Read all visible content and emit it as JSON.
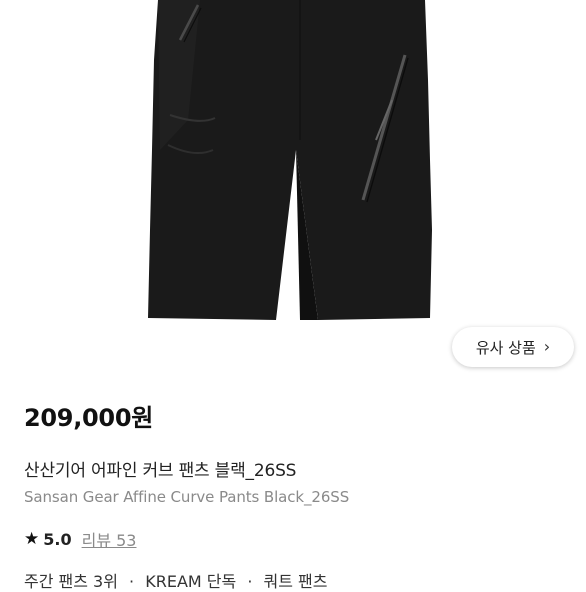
{
  "product": {
    "price": "209,000원",
    "name_ko": "산산기어 어파인 커브 팬츠 블랙_26SS",
    "name_en": "Sansan Gear Affine Curve Pants Black_26SS",
    "rating": "5.0",
    "reviews_label": "리뷰 53",
    "image_color": "#1a1a1a"
  },
  "similar_button": {
    "label": "유사 상품",
    "icon": "chevron-right-icon"
  },
  "tags": [
    "주간 팬츠 3위",
    "·",
    "KREAM 단독",
    "·",
    "쿼트 팬츠"
  ]
}
